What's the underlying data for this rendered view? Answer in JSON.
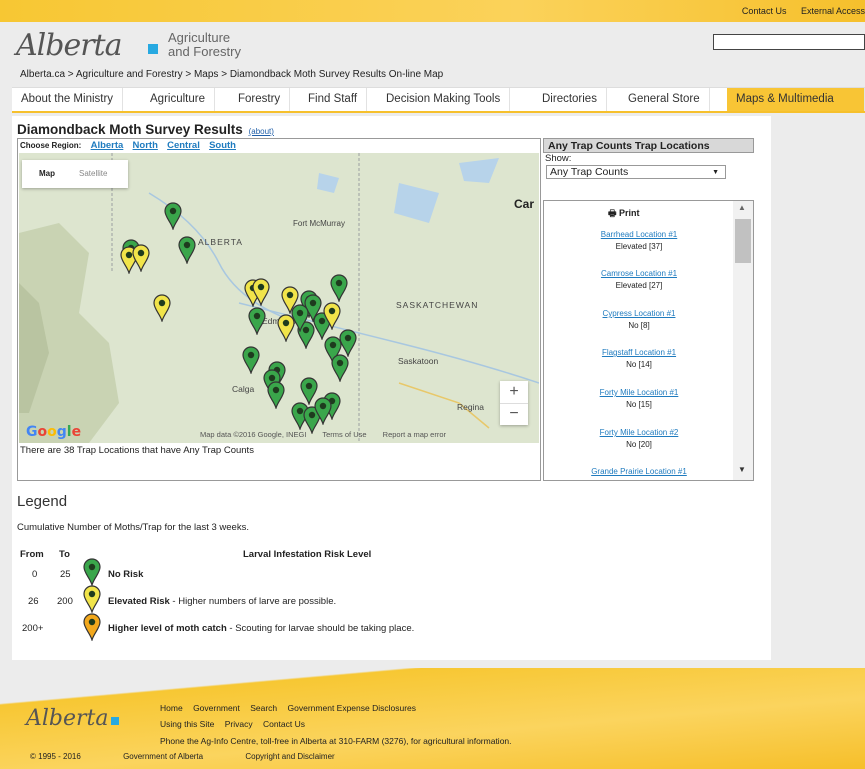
{
  "header": {
    "top_links": [
      "Contact Us",
      "External Access"
    ],
    "logo_text": "Alberta",
    "dept_line1": "Agriculture",
    "dept_line2": "and Forestry",
    "breadcrumb": "Alberta.ca > Agriculture and Forestry > Maps > Diamondback Moth Survey Results On-line Map"
  },
  "nav": {
    "items": [
      "About the Ministry",
      "Agriculture",
      "Forestry",
      "Find Staff",
      "Decision Making Tools",
      "Directories",
      "General Store",
      "Maps & Multimedia"
    ],
    "active": "Maps & Multimedia"
  },
  "page": {
    "title": "Diamondback Moth Survey Results",
    "about_link": "(about)",
    "choose_region_label": "Choose Region:",
    "regions": [
      "Alberta",
      "North",
      "Central",
      "South"
    ],
    "status": "There are 38 Trap Locations that have Any Trap Counts"
  },
  "map": {
    "toggle": [
      "Map",
      "Satellite"
    ],
    "labels": [
      "ALBERTA",
      "SASKATCHEWAN",
      "Fort McMurray",
      "Saskatoon",
      "Regina",
      "Calga",
      "Edmonton",
      "Car"
    ],
    "zoom_in": "+",
    "zoom_out": "−",
    "google": "Google",
    "footer_links": [
      "Map data ©2016 Google, INEGI",
      "Terms of Use",
      "Report a map error"
    ],
    "colors": {
      "green": "#3aa64b",
      "yellow": "#f1e44a",
      "orange": "#f2a81d"
    }
  },
  "panel": {
    "header": "Any Trap Counts Trap Locations",
    "show_label": "Show:",
    "select_value": "Any Trap Counts",
    "print_label": "Print",
    "locations": [
      {
        "name": "Barrhead Location #1",
        "value": "Elevated [37]"
      },
      {
        "name": "Camrose Location #1",
        "value": "Elevated [27]"
      },
      {
        "name": "Cypress Location #1",
        "value": "No [8]"
      },
      {
        "name": "Flagstaff Location #1",
        "value": "No [14]"
      },
      {
        "name": "Forty Mile Location #1",
        "value": "No [15]"
      },
      {
        "name": "Forty Mile Location #2",
        "value": "No [20]"
      },
      {
        "name": "Grande Prairie Location #1",
        "value": ""
      }
    ]
  },
  "legend": {
    "title": "Legend",
    "subtitle": "Cumulative Number of Moths/Trap for the last 3 weeks.",
    "col_from": "From",
    "col_to": "To",
    "col_risk": "Larval Infestation Risk Level",
    "rows": [
      {
        "from": "0",
        "to": "25",
        "label": "No Risk",
        "desc": "",
        "color": "#3aa64b"
      },
      {
        "from": "26",
        "to": "200",
        "label": "Elevated Risk",
        "desc": " - Higher numbers of larve are possible.",
        "color": "#f1e44a"
      },
      {
        "from": "200+",
        "to": "",
        "label": "Higher level of moth catch",
        "desc": " - Scouting for larvae should be taking place.",
        "color": "#f2a81d"
      }
    ]
  },
  "footer": {
    "logo_text": "Alberta",
    "links1": [
      "Home",
      "Government",
      "Search",
      "Government Expense Disclosures"
    ],
    "links2": [
      "Using this Site",
      "Privacy",
      "Contact Us"
    ],
    "phone": "Phone the Ag-Info Centre, toll-free in Alberta at 310-FARM (3276), for agricultural information.",
    "bottom": [
      "© 1995 - 2016",
      "Government of Alberta",
      "Copyright and Disclaimer"
    ]
  }
}
